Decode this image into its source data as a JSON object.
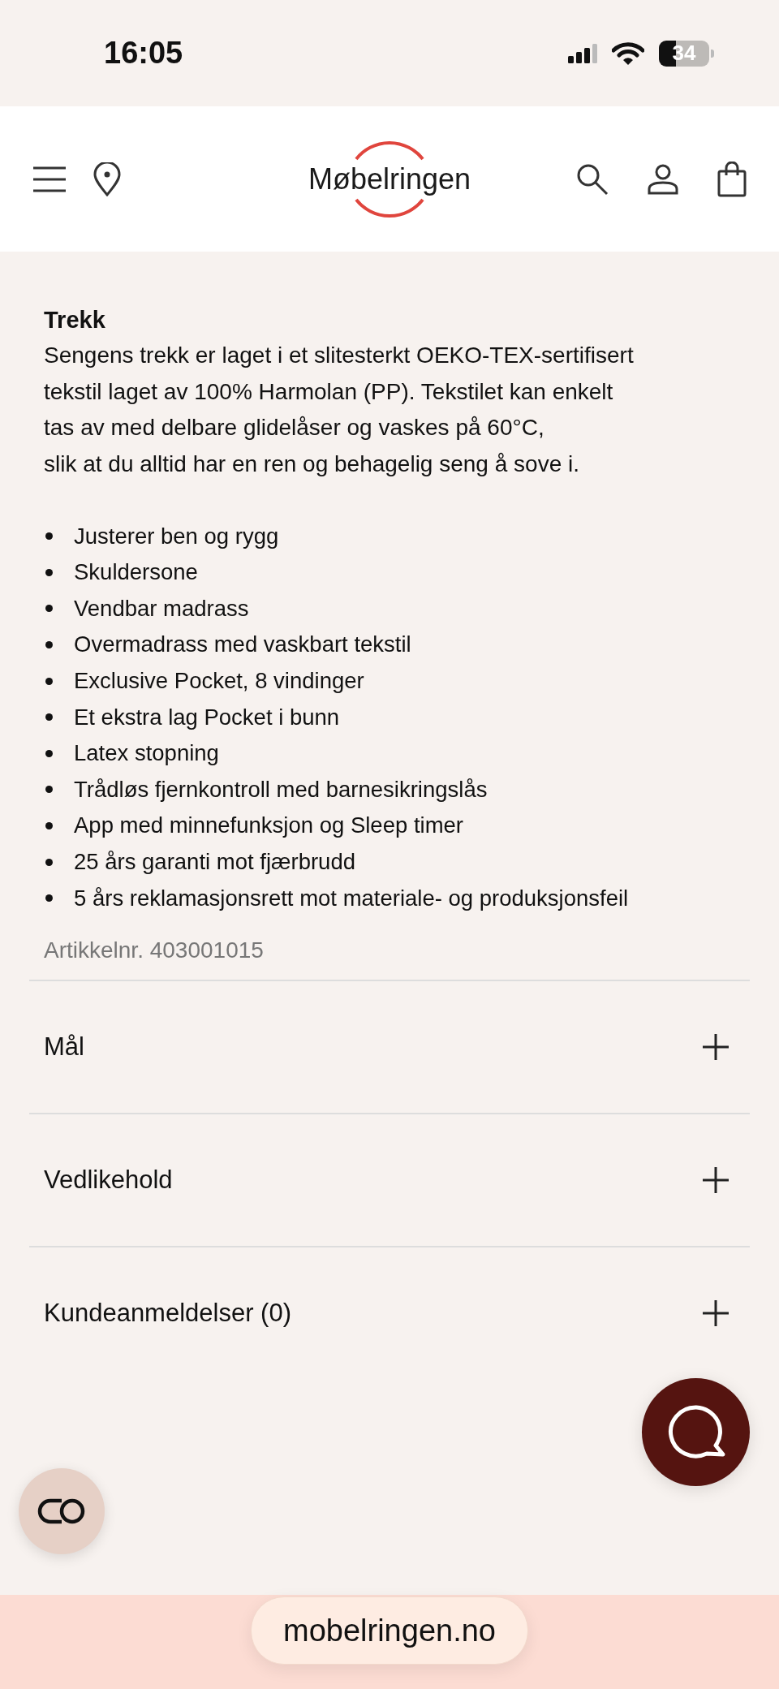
{
  "status_bar": {
    "time": "16:05",
    "battery": "34"
  },
  "header": {
    "logo": "Møbelringen"
  },
  "section": {
    "heading": "Trekk",
    "paragraph_lines": [
      "Sengens trekk er laget i et slitesterkt OEKO-TEX-sertifisert",
      "tekstil laget av 100% Harmolan (PP). Tekstilet kan enkelt",
      "tas av med delbare glidelåser og vaskes på 60°C,",
      "slik at du alltid har en ren og behagelig seng å sove i."
    ],
    "features": [
      "Justerer ben og rygg",
      "Skuldersone",
      "Vendbar madrass",
      "Overmadrass med vaskbart tekstil",
      "Exclusive Pocket, 8 vindinger",
      "Et ekstra lag Pocket i bunn",
      "Latex stopning",
      "Trådløs fjernkontroll med barnesikringslås",
      "App med minnefunksjon og Sleep timer",
      "25 års garanti mot fjærbrudd",
      "5 års reklamasjonsrett mot materiale- og produksjonsfeil"
    ],
    "article_number": "Artikkelnr. 403001015"
  },
  "accordions": [
    {
      "label": "Mål",
      "expanded": false
    },
    {
      "label": "Vedlikehold",
      "expanded": false
    },
    {
      "label": "Kundeanmeldelser (0)",
      "expanded": false
    }
  ],
  "browser_bar": {
    "url": "mobelringen.no"
  }
}
